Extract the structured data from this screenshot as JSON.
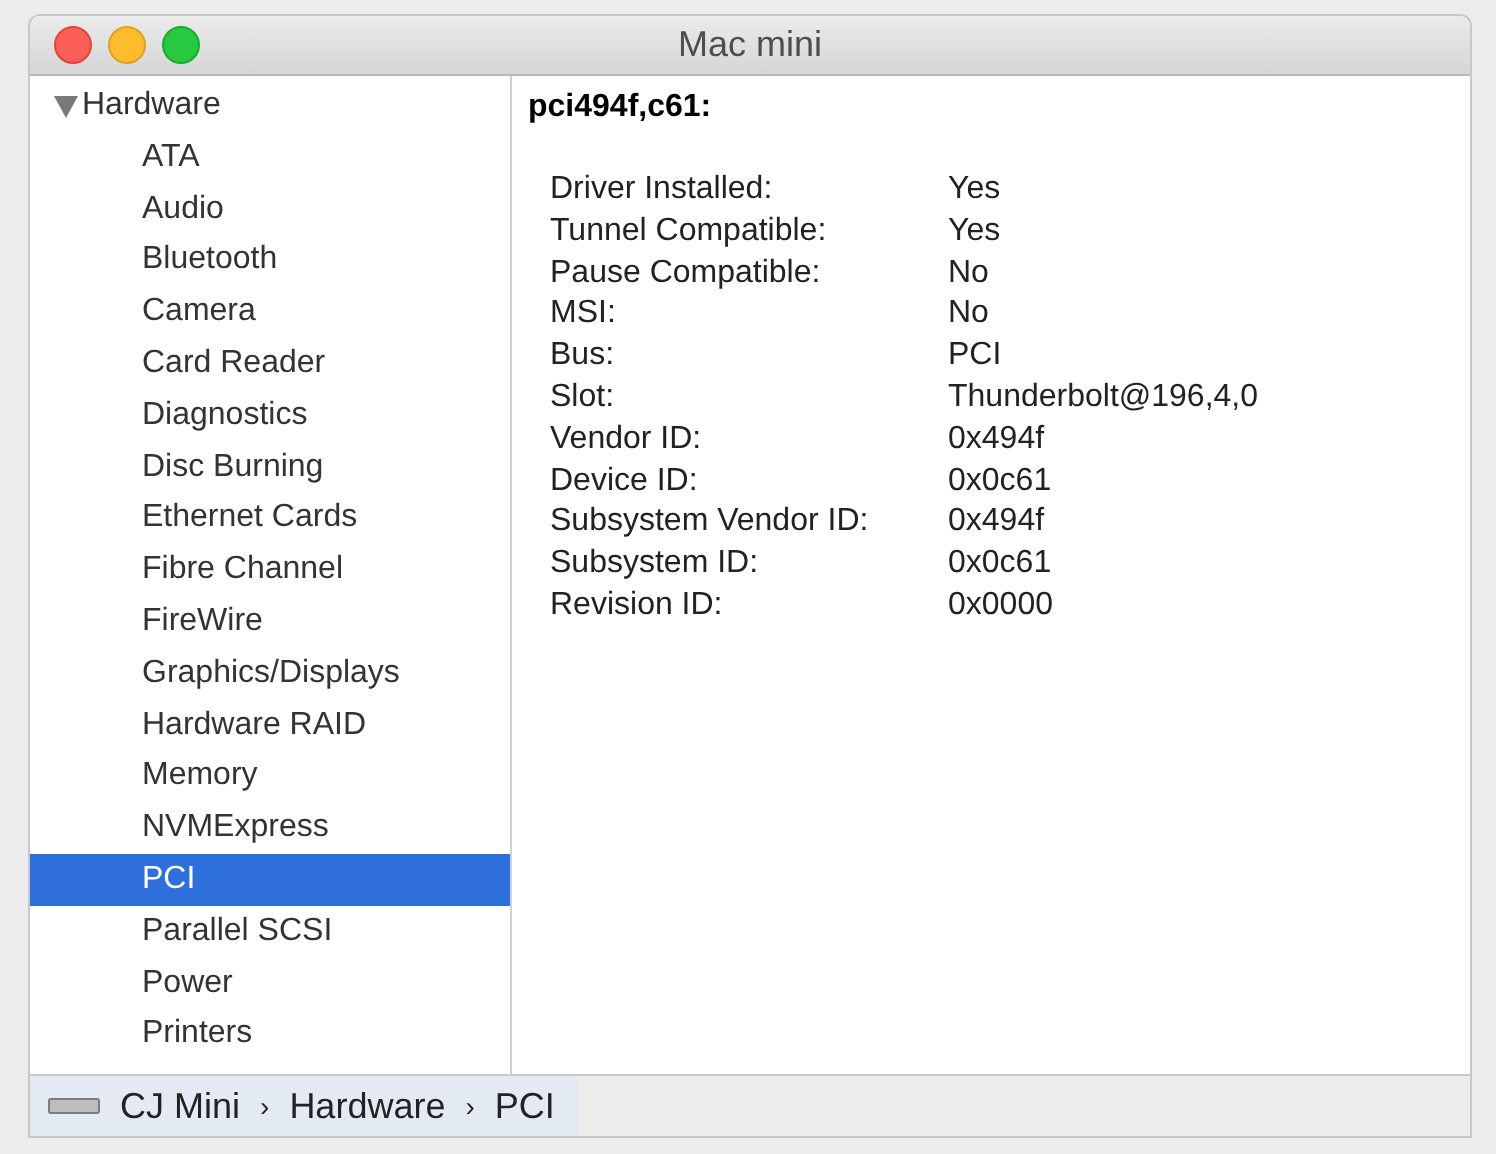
{
  "window": {
    "title": "Mac mini"
  },
  "sidebar": {
    "group": {
      "label": "Hardware",
      "expanded": true
    },
    "items": [
      {
        "label": "ATA",
        "selected": false
      },
      {
        "label": "Audio",
        "selected": false
      },
      {
        "label": "Bluetooth",
        "selected": false
      },
      {
        "label": "Camera",
        "selected": false
      },
      {
        "label": "Card Reader",
        "selected": false
      },
      {
        "label": "Diagnostics",
        "selected": false
      },
      {
        "label": "Disc Burning",
        "selected": false
      },
      {
        "label": "Ethernet Cards",
        "selected": false
      },
      {
        "label": "Fibre Channel",
        "selected": false
      },
      {
        "label": "FireWire",
        "selected": false
      },
      {
        "label": "Graphics/Displays",
        "selected": false
      },
      {
        "label": "Hardware RAID",
        "selected": false
      },
      {
        "label": "Memory",
        "selected": false
      },
      {
        "label": "NVMExpress",
        "selected": false
      },
      {
        "label": "PCI",
        "selected": true
      },
      {
        "label": "Parallel SCSI",
        "selected": false
      },
      {
        "label": "Power",
        "selected": false
      },
      {
        "label": "Printers",
        "selected": false
      }
    ]
  },
  "detail": {
    "heading": "pci494f,c61:",
    "rows": [
      {
        "label": "Driver Installed:",
        "value": "Yes"
      },
      {
        "label": "Tunnel Compatible:",
        "value": "Yes"
      },
      {
        "label": "Pause Compatible:",
        "value": "No"
      },
      {
        "label": "MSI:",
        "value": "No"
      },
      {
        "label": "Bus:",
        "value": "PCI"
      },
      {
        "label": "Slot:",
        "value": "Thunderbolt@196,4,0"
      },
      {
        "label": "Vendor ID:",
        "value": "0x494f"
      },
      {
        "label": "Device ID:",
        "value": "0x0c61"
      },
      {
        "label": "Subsystem Vendor ID:",
        "value": "0x494f"
      },
      {
        "label": "Subsystem ID:",
        "value": "0x0c61"
      },
      {
        "label": "Revision ID:",
        "value": "0x0000"
      }
    ]
  },
  "path_bar": {
    "segments": [
      "CJ Mini",
      "Hardware",
      "PCI"
    ],
    "separator": "›"
  }
}
